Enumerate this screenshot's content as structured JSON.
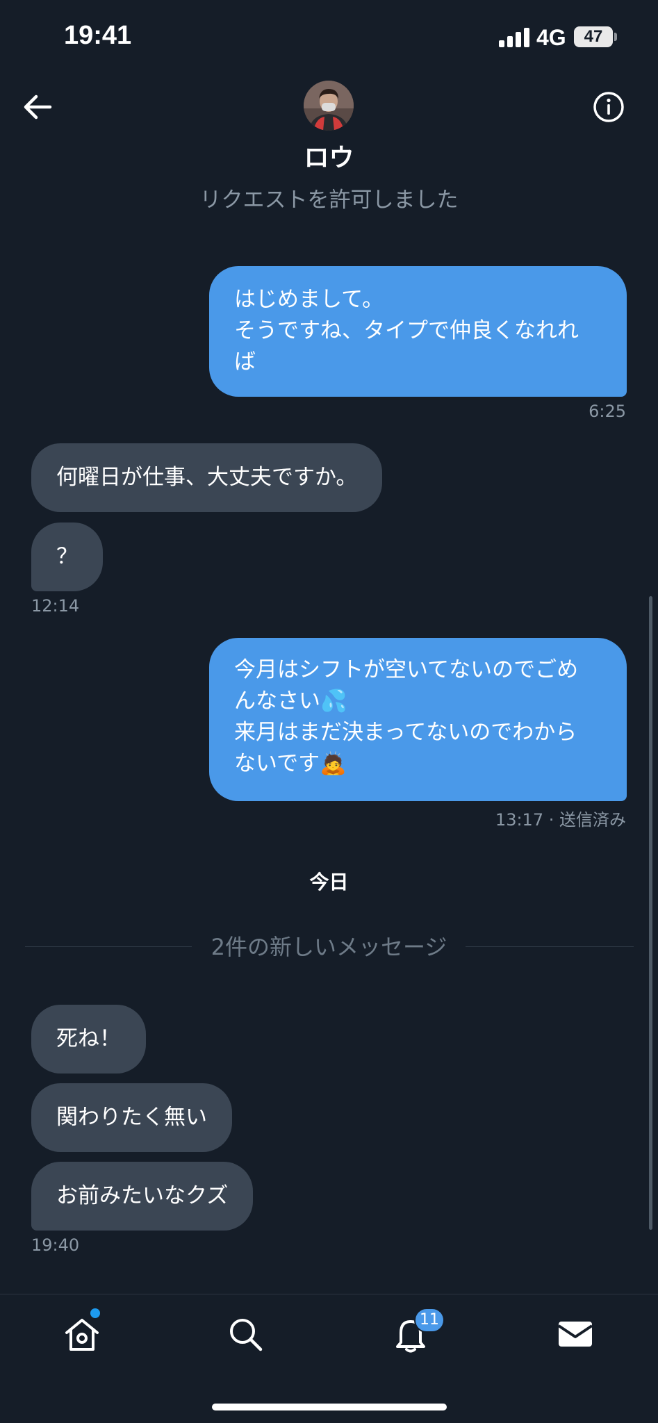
{
  "status_bar": {
    "time": "19:41",
    "network": "4G",
    "battery": "47",
    "icons": [
      "signal-icon",
      "battery-icon"
    ]
  },
  "header": {
    "contact_name": "ロウ",
    "request_status": "リクエストを許可しました",
    "icons": [
      "back-arrow-icon",
      "info-icon"
    ]
  },
  "messages": [
    {
      "direction": "sent",
      "lines": [
        "はじめまして。",
        "そうですね、タイプで仲良くなれれ",
        "ば"
      ],
      "time": "6:25"
    },
    {
      "direction": "received",
      "text": "何曜日が仕事、大丈夫ですか。"
    },
    {
      "direction": "received",
      "text": "？",
      "time": "12:14"
    },
    {
      "direction": "sent",
      "lines": [
        "今月はシフトが空いてないのでごめ",
        "んなさい💦",
        "来月はまだ決まってないのでわから",
        "ないです🙇"
      ],
      "time": "13:17",
      "status": "· 送信済み"
    }
  ],
  "day_separator": "今日",
  "new_messages_divider": "2件の新しいメッセージ",
  "new_messages": [
    {
      "direction": "received",
      "text": "死ね！"
    },
    {
      "direction": "received",
      "text": "関わりたく無い"
    },
    {
      "direction": "received",
      "text": "お前みたいなクズ",
      "time": "19:40"
    }
  ],
  "bottom_nav": {
    "items": [
      "home-icon",
      "search-icon",
      "notifications-icon",
      "messages-icon"
    ],
    "notification_count": "11"
  },
  "colors": {
    "background": "#151d28",
    "sent_bubble": "#4a99e9",
    "received_bubble": "#3b4654",
    "secondary_text": "#8b98a5",
    "badge": "#1d9bf0"
  }
}
